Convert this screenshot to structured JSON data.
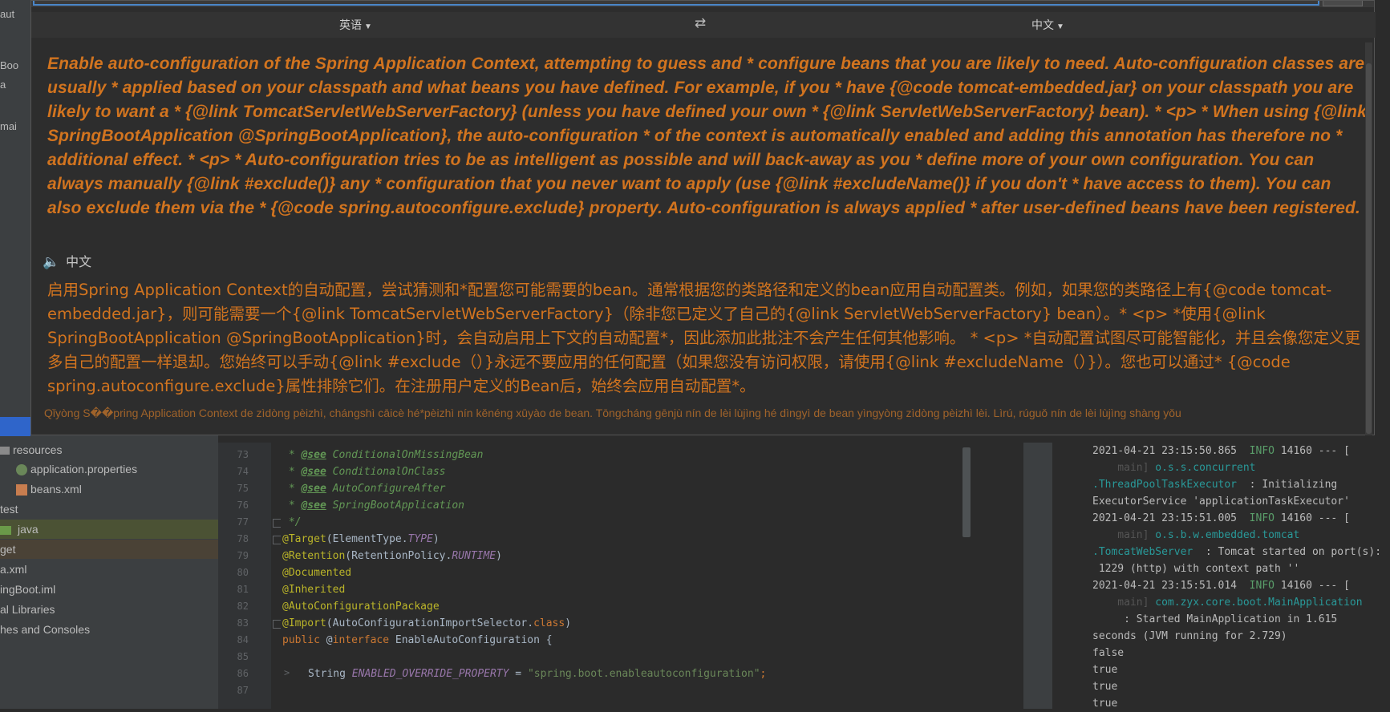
{
  "ide": {
    "left_cut_labels": [
      "aut",
      "Boo",
      "a",
      "mai"
    ],
    "project_tree": [
      {
        "label": "resources",
        "icon": "folder-icon"
      },
      {
        "label": "application.properties",
        "icon": "properties-file-icon"
      },
      {
        "label": "beans.xml",
        "icon": "xml-file-icon"
      },
      {
        "label": "test",
        "icon": ""
      },
      {
        "label": "java",
        "icon": "folder-green-icon"
      },
      {
        "label": "get",
        "icon": ""
      },
      {
        "label": "a.xml",
        "icon": ""
      },
      {
        "label": "ingBoot.iml",
        "icon": ""
      },
      {
        "label": "al Libraries",
        "icon": ""
      },
      {
        "label": "hes and Consoles",
        "icon": ""
      }
    ],
    "line_numbers": [
      "73",
      "74",
      "75",
      "76",
      "77",
      "78",
      "79",
      "80",
      "81",
      "82",
      "83",
      "84",
      "85",
      "86",
      "87"
    ],
    "code": {
      "l73_tag": "@see",
      "l73_text": " ConditionalOnMissingBean",
      "l74_tag": "@see",
      "l74_text": " ConditionalOnClass",
      "l75_tag": "@see",
      "l75_text": " AutoConfigureAfter",
      "l76_tag": "@see",
      "l76_text": " SpringBootApplication",
      "l77": " */",
      "l78_ann": "@Target",
      "l78_a": "(ElementType.",
      "l78_f": "TYPE",
      "l78_b": ")",
      "l79_ann": "@Retention",
      "l79_a": "(RetentionPolicy.",
      "l79_f": "RUNTIME",
      "l79_b": ")",
      "l80_ann": "@Documented",
      "l81_ann": "@Inherited",
      "l82_ann": "@AutoConfigurationPackage",
      "l83_ann": "@Import",
      "l83_a": "(AutoConfigurationImportSelector.",
      "l83_k": "class",
      "l83_b": ")",
      "l84_kw": "public",
      "l84_a": " @",
      "l84_kw2": "interface",
      "l84_b": " EnableAutoConfiguration {",
      "l86_a": "String ",
      "l86_f": "ENABLED_OVERRIDE_PROPERTY",
      "l86_b": " = ",
      "l86_s": "\"spring.boot.enableautoconfiguration\"",
      "l86_c": ";"
    },
    "console": {
      "l1_ts": "2021-04-21 23:15:50.865",
      "l1_info": "  INFO",
      "l1_rest": " 14160 --- [",
      "l2_a": "    main] ",
      "l2_pkg": "o.s.s.concurrent",
      "l3_pkg": ".ThreadPoolTaskExecutor",
      "l3_rest": "  : Initializing",
      "l4": "ExecutorService 'applicationTaskExecutor'",
      "l5_ts": "2021-04-21 23:15:51.005",
      "l5_info": "  INFO",
      "l5_rest": " 14160 --- [",
      "l6_a": "    main] ",
      "l6_pkg": "o.s.b.w.embedded.tomcat",
      "l7_pkg": ".TomcatWebServer",
      "l7_rest": "  : Tomcat started on port(s):",
      "l8": " 1229 (http) with context path ''",
      "l9_ts": "2021-04-21 23:15:51.014",
      "l9_info": "  INFO",
      "l9_rest": " 14160 --- [",
      "l10_a": "    main] ",
      "l10_pkg": "com.zyx.core.boot.MainApplication",
      "l11": "     : Started MainApplication in 1.615",
      "l12": "seconds (JVM running for 2.729)",
      "l13": "false",
      "l14": "true",
      "l15": "true",
      "l16": "true"
    }
  },
  "translator": {
    "source_lang": "英语",
    "target_lang": "中文",
    "swap_icon": "swap-arrows-icon",
    "source_text": "Enable auto-configuration of the Spring Application Context, attempting to guess and * configure beans that you are likely to need. Auto-configuration classes are usually * applied based on your classpath and what beans you have defined. For example, if you * have {@code tomcat-embedded.jar} on your classpath you are likely to want a * {@link TomcatServletWebServerFactory} (unless you have defined your own * {@link ServletWebServerFactory} bean). * <p> * When using {@link SpringBootApplication @SpringBootApplication}, the auto-configuration * of the context is automatically enabled and adding this annotation has therefore no * additional effect. * <p> * Auto-configuration tries to be as intelligent as possible and will back-away as you * define more of your own configuration. You can always manually {@link #exclude()} any * configuration that you never want to apply (use {@link #excludeName()} if you don't * have access to them). You can also exclude them via the * {@code spring.autoconfigure.exclude} property. Auto-configuration is always applied * after user-defined beans have been registered.",
    "tts_label": "中文",
    "translated_text": "启用Spring Application Context的自动配置，尝试猜测和*配置您可能需要的bean。通常根据您的类路径和定义的bean应用自动配置类。例如，如果您的类路径上有{@code tomcat-embedded.jar}，则可能需要一个{@link TomcatServletWebServerFactory}（除非您已定义了自己的{@link ServletWebServerFactory} bean）。* <p> *使用{@link SpringBootApplication @SpringBootApplication}时，会自动启用上下文的自动配置*，因此添加此批注不会产生任何其他影响。 * <p> *自动配置试图尽可能智能化，并且会像您定义更多自己的配置一样退却。您始终可以手动{@link #exclude（）}永远不要应用的任何配置（如果您没有访问权限，请使用{@link #excludeName（）}）。您也可以通过* {@code spring.autoconfigure.exclude}属性排除它们。在注册用户定义的Bean后，始终会应用自动配置*。",
    "pinyin": "Qǐyòng S��pring Application Context de zìdòng pèizhì, chángshì cāicè hé*pèizhì nín kěnéng xūyào de bean. Tōngcháng gēnjù nín de lèi lùjìng hé dìngyì de bean yìngyòng zìdòng pèizhì lèi. Lìrú, rúguǒ nín de lèi lùjìng shàng yǒu"
  }
}
